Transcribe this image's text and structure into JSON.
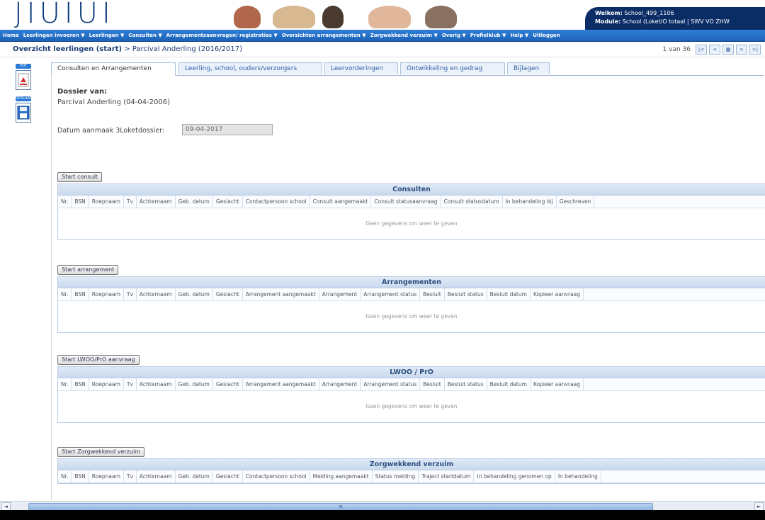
{
  "header": {
    "logo_text": "JIUIUI",
    "welcome_label": "Welkom:",
    "welcome_value": "School_499_1106",
    "module_label": "Module:",
    "module_value": "School (Loket/O totaal | SWV VO ZHW"
  },
  "menu": [
    "Home",
    "Leerlingen invoeren ▼",
    "Leerlingen ▼",
    "Consulten ▼",
    "Arrangementsaanvragen/ registraties ▼",
    "Overzichten arrangementen ▼",
    "Zorgwekkend verzuim ▼",
    "Overig ▼",
    "Profielklub ▼",
    "Help ▼",
    "Uitloggen"
  ],
  "breadcrumb": {
    "link": "Overzicht leerlingen (start)",
    "separator": ">",
    "current": "Parcival Anderling (2016/2017)"
  },
  "pager": {
    "info": "1 van 36",
    "buttons": [
      "|<",
      "<",
      "▦",
      ">",
      ">|"
    ]
  },
  "side_icons": [
    {
      "label": "PDF",
      "icon": "pdf-icon"
    },
    {
      "label": "OPSLAAN",
      "icon": "save-icon"
    }
  ],
  "tabs": [
    "Consulten en Arrangementen",
    "Leerling, school, ouders/verzorgers",
    "Leervorderingen",
    "Ontwikkeling en gedrag",
    "Bijlagen"
  ],
  "dossier": {
    "label": "Dossier van:",
    "name": "Parcival Anderling (04-04-2006)",
    "datum_label": "Datum aanmaak 3Loketdossier:",
    "datum_value": "09-04-2017"
  },
  "sections": [
    {
      "button": "Start consult",
      "title": "Consulten",
      "columns": [
        "Nr.",
        "BSN",
        "Roepnaam",
        "Tv",
        "Achternaam",
        "Geb. datum",
        "Geslacht",
        "Contactpersoon school",
        "Consult aangemaakt",
        "Consult statusaanvraag",
        "Consult statusdatum",
        "In behandeling bij",
        "Geschreven"
      ],
      "empty": "Geen gegevens om weer te geven"
    },
    {
      "button": "Start arrangement",
      "title": "Arrangementen",
      "columns": [
        "Nr.",
        "BSN",
        "Roepnaam",
        "Tv",
        "Achternaam",
        "Geb. datum",
        "Geslacht",
        "Arrangement aangemaakt",
        "Arrangement",
        "Arrangement status",
        "Besluit",
        "Besluit status",
        "Besluit datum",
        "Kopieer aanvraag"
      ],
      "empty": "Geen gegevens om weer te geven"
    },
    {
      "button": "Start LWOO/PrO aanvraag",
      "title": "LWOO / PrO",
      "columns": [
        "Nr.",
        "BSN",
        "Roepnaam",
        "Tv",
        "Achternaam",
        "Geb. datum",
        "Geslacht",
        "Arrangement aangemaakt",
        "Arrangement",
        "Arrangement status",
        "Besluit",
        "Besluit status",
        "Besluit datum",
        "Kopieer aanvraag"
      ],
      "empty": "Geen gegevens om weer te geven"
    },
    {
      "button": "Start Zorgwekkend verzuim",
      "title": "Zorgwekkend verzuim",
      "columns": [
        "Nr.",
        "BSN",
        "Roepnaam",
        "Tv",
        "Achternaam",
        "Geb. datum",
        "Geslacht",
        "Contactpersoon school",
        "Melding aangemaakt",
        "Status melding",
        "Traject startdatum",
        "In behandeling genomen op",
        "In behandeling"
      ],
      "empty": ""
    }
  ],
  "scrollbar": {
    "left": "◄",
    "right": "►",
    "grip": "≡"
  }
}
